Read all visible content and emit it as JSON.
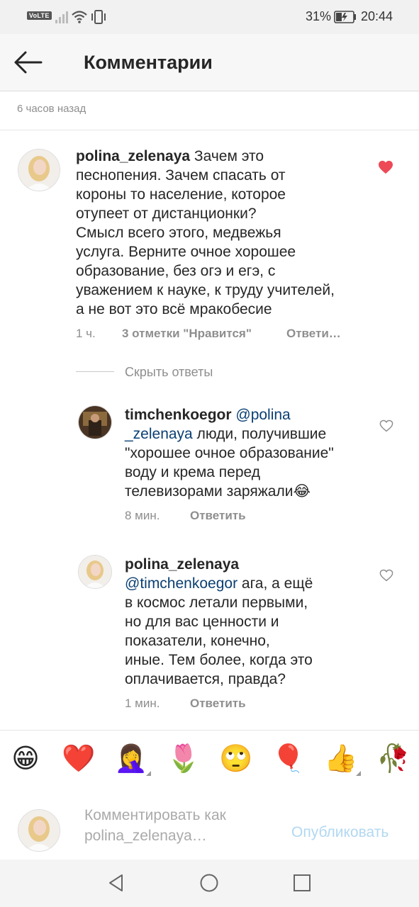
{
  "status_bar": {
    "volte": "VoLTE",
    "battery_percent": "31%",
    "time": "20:44"
  },
  "header": {
    "title": "Комментарии"
  },
  "post_meta": "6 часов назад",
  "comments": [
    {
      "username": "polina_zelenaya",
      "text": "Зачем это песнопения. Зачем спасать от короны то население, которое отупеет от дистанционки? Смысл всего этого, медвежья услуга. Верните очное хорошее образование, без огэ и егэ, с уважением к науке, к труду учителей, а не вот это всё мракобесие",
      "lines": [
        "Зачем это",
        "песнопения. Зачем спасать от",
        "короны то население, которое",
        "отупеет от дистанционки?",
        "Смысл всего этого, медвежья",
        "услуга. Верните очное хорошее",
        "образование, без огэ и егэ, с",
        "уважением к науке, к труду учителей,",
        "а не вот это всё мракобесие"
      ],
      "time": "1 ч.",
      "likes": "3 отметки \"Нравится\"",
      "reply_label": "Ответи…",
      "liked": true
    }
  ],
  "hide_replies": "Скрыть ответы",
  "replies": [
    {
      "username": "timchenkoegor",
      "mention_part1": "@polina",
      "mention_part2": "_zelenaya",
      "lines": [
        "люди, получившие",
        "\"хорошее очное образование\"",
        "воду и крема перед",
        "телевизорами заряжали😂"
      ],
      "time": "8 мин.",
      "reply_label": "Ответить",
      "liked": false
    },
    {
      "username": "polina_zelenaya",
      "mention": "@timchenkoegor",
      "lines": [
        "ага, а ещё",
        "в космос летали первыми,",
        "но для вас ценности и",
        "показатели, конечно,",
        "иные. Тем более, когда это",
        "оплачивается, правда?"
      ],
      "time": "1 мин.",
      "reply_label": "Ответить",
      "liked": false
    }
  ],
  "emoji_bar": [
    "😁",
    "❤️",
    "🤦‍♀️",
    "🌷",
    "🙄",
    "🎈",
    "👍",
    "🥀"
  ],
  "compose": {
    "placeholder_line1": "Комментировать как",
    "placeholder_line2": "polina_zelenaya…",
    "publish_label": "Опубликовать"
  },
  "colors": {
    "like_red": "#ed4956",
    "mention_blue": "#0b3f73",
    "publish_disabled": "#b2d8f2",
    "meta_gray": "#8e8e8e"
  },
  "icons": {
    "back": "arrow-left-icon",
    "heart_filled": "heart-filled-icon",
    "heart_outline": "heart-outline-icon",
    "nav_back": "nav-back-icon",
    "nav_home": "nav-home-icon",
    "nav_recents": "nav-recents-icon"
  }
}
